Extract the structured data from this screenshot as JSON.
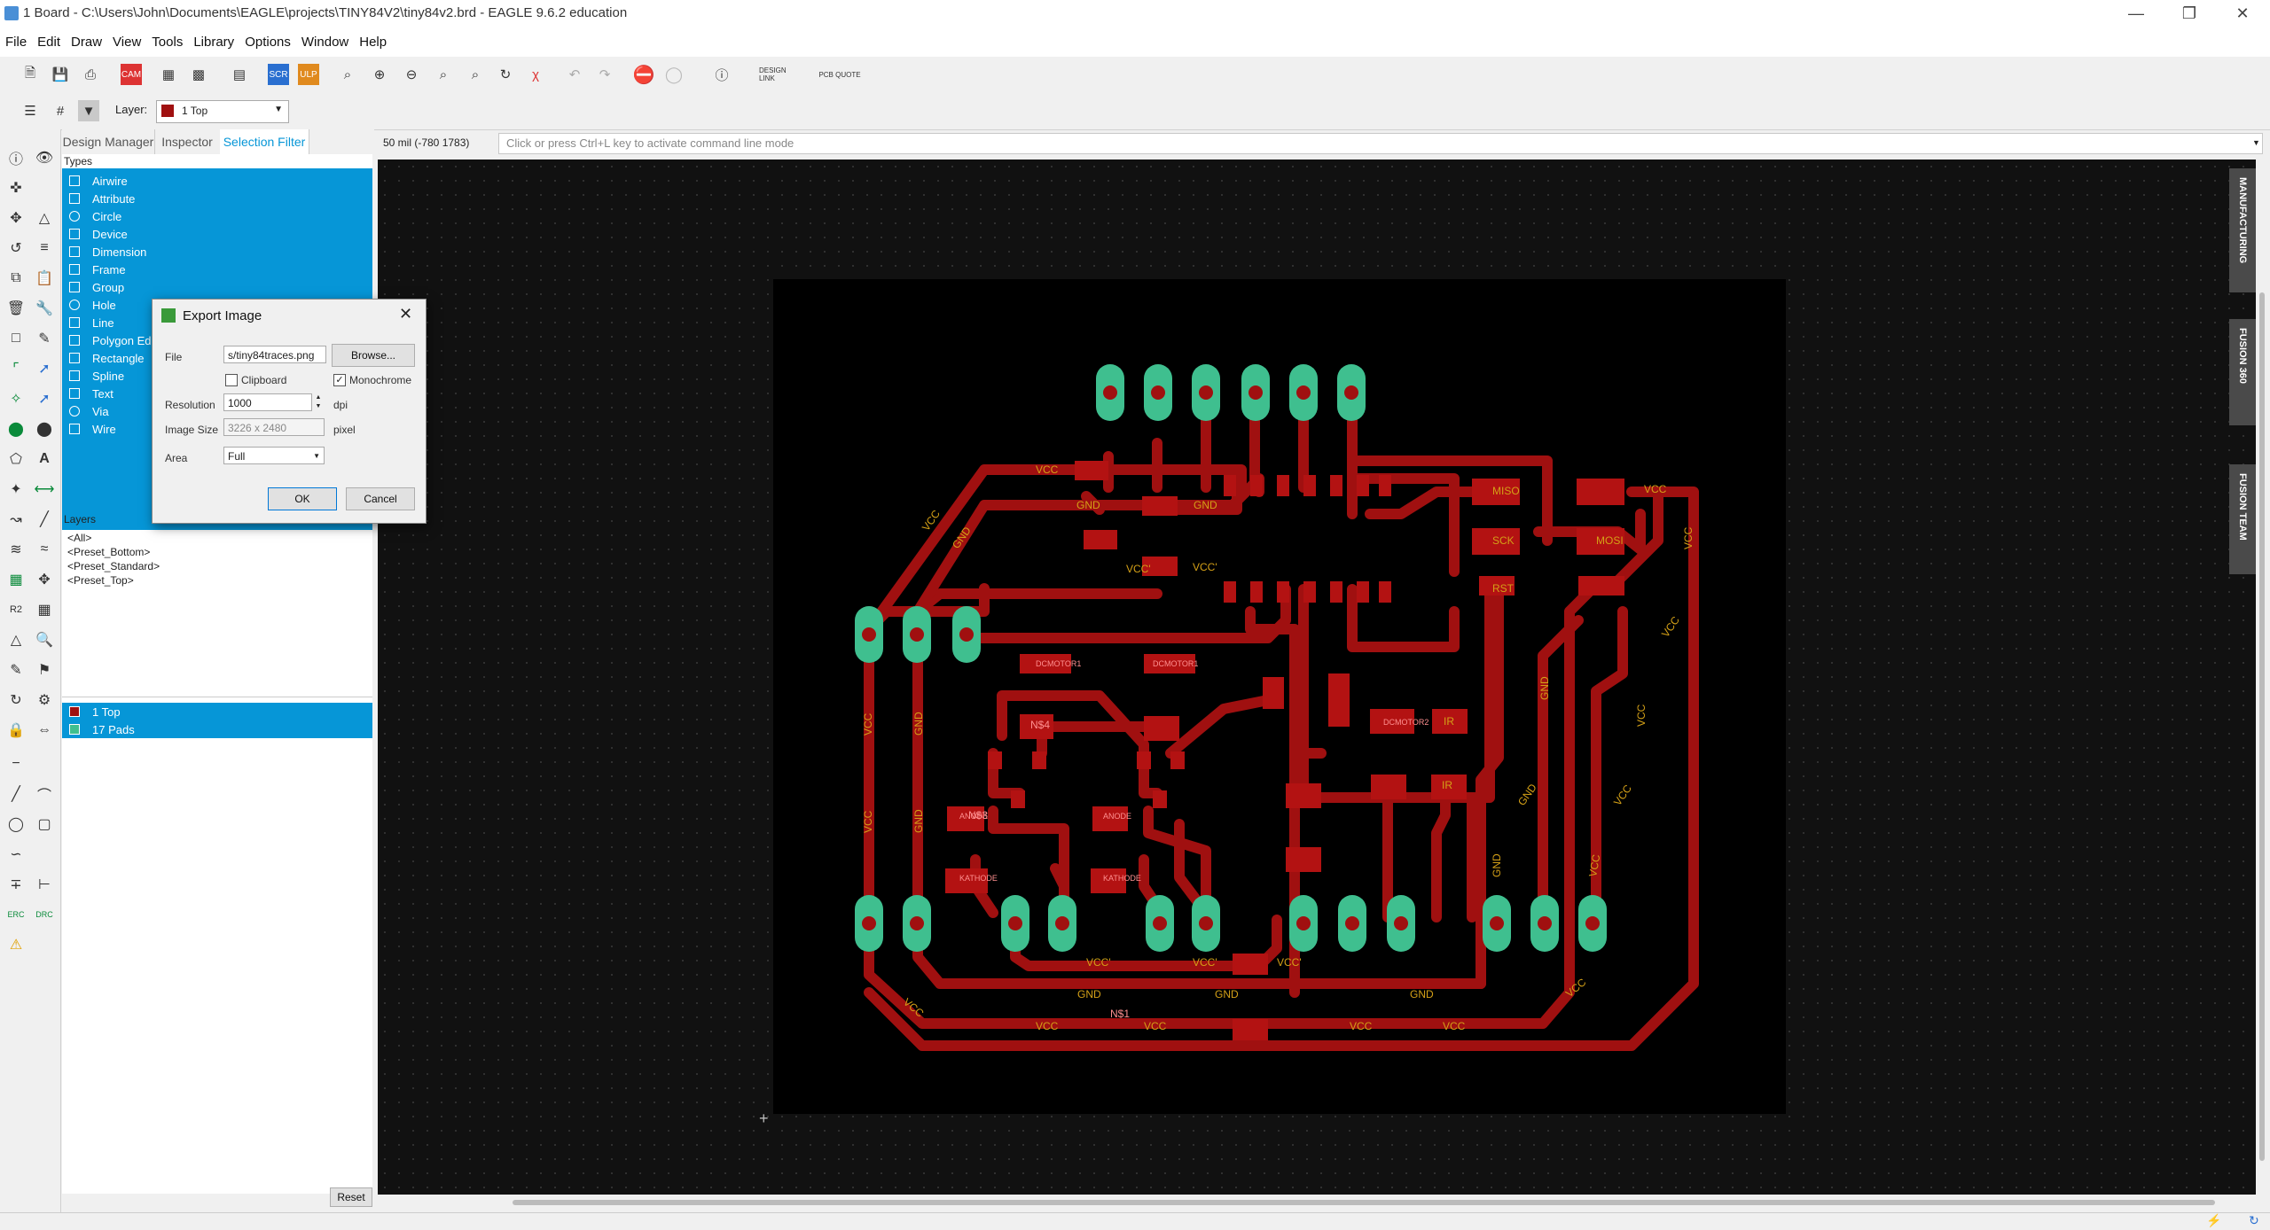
{
  "window": {
    "title": "1 Board - C:\\Users\\John\\Documents\\EAGLE\\projects\\TINY84V2\\tiny84v2.brd - EAGLE 9.6.2 education"
  },
  "menu": [
    "File",
    "Edit",
    "Draw",
    "View",
    "Tools",
    "Library",
    "Options",
    "Window",
    "Help"
  ],
  "toolbar": {
    "design_link_label": "DESIGN LINK",
    "pcb_quote_label": "PCB QUOTE",
    "layer_label": "Layer:",
    "layer_value": "1 Top"
  },
  "panel": {
    "tabs": [
      "Design Manager",
      "Inspector",
      "Selection Filter"
    ],
    "active_tab": "Selection Filter",
    "types_header": "Types",
    "types": [
      "Airwire",
      "Attribute",
      "Circle",
      "Device",
      "Dimension",
      "Frame",
      "Group",
      "Hole",
      "Line",
      "Polygon Edge",
      "Rectangle",
      "Spline",
      "Text",
      "Via",
      "Wire"
    ],
    "layers_header": "Layers",
    "presets": [
      "<All>",
      "<Preset_Bottom>",
      "<Preset_Standard>",
      "<Preset_Top>"
    ],
    "selected_layers": [
      "1 Top",
      "17 Pads"
    ],
    "reset_label": "Reset"
  },
  "canvas": {
    "coordinate_readout": "50 mil (-780 1783)",
    "command_placeholder": "Click or press Ctrl+L key to activate command line mode",
    "side_tabs": [
      "MANUFACTURING",
      "FUSION 360",
      "FUSION TEAM"
    ]
  },
  "dialog": {
    "title": "Export Image",
    "file_label": "File",
    "file_value": "s/tiny84traces.png",
    "browse_label": "Browse...",
    "clipboard_label": "Clipboard",
    "clipboard_checked": false,
    "monochrome_label": "Monochrome",
    "monochrome_checked": true,
    "resolution_label": "Resolution",
    "resolution_value": "1000",
    "resolution_unit": "dpi",
    "image_size_label": "Image Size",
    "image_size_value": "3226 x 2480",
    "image_size_unit": "pixel",
    "area_label": "Area",
    "area_value": "Full",
    "ok_label": "OK",
    "cancel_label": "Cancel"
  },
  "pcb": {
    "net_labels": [
      "VCC",
      "GND",
      "VCC'"
    ],
    "part_labels": [
      "MISO",
      "SCK",
      "MOSI",
      "RST",
      "DCMOTOR1",
      "DCMOTOR2",
      "ANODE",
      "KATHODE",
      "IR",
      "N$1",
      "N$3",
      "N$4"
    ],
    "colors": {
      "trace": "#a01010",
      "pad": "#3fbf8f",
      "label": "#d4a017",
      "board": "#000000"
    }
  }
}
